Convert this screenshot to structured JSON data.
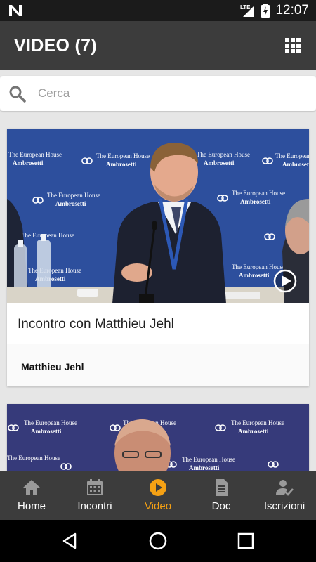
{
  "status_bar": {
    "time": "12:07",
    "network": "LTE",
    "icons": [
      "n-logo-icon",
      "signal-icon",
      "battery-charging-icon"
    ]
  },
  "app_bar": {
    "title": "VIDEO (7)",
    "menu_icon": "grid-icon"
  },
  "search": {
    "placeholder": "Cerca",
    "value": "",
    "icon": "search-icon"
  },
  "videos": [
    {
      "title": "Incontro con Matthieu Jehl",
      "author": "Matthieu Jehl",
      "thumbnail_banner_text": [
        "The European House",
        "Ambrosetti"
      ],
      "play_icon": "play-circle-icon"
    },
    {
      "title": "",
      "author": "",
      "thumbnail_banner_text": [
        "The European House",
        "Ambrosetti"
      ]
    }
  ],
  "bottom_nav": {
    "active": "Video",
    "items": [
      {
        "label": "Home",
        "icon": "home-icon"
      },
      {
        "label": "Incontri",
        "icon": "calendar-icon"
      },
      {
        "label": "Video",
        "icon": "play-circle-icon"
      },
      {
        "label": "Doc",
        "icon": "document-icon"
      },
      {
        "label": "Iscrizioni",
        "icon": "person-check-icon"
      }
    ]
  },
  "system_nav": {
    "icons": [
      "back-icon",
      "home-circle-icon",
      "recents-icon"
    ]
  },
  "colors": {
    "app_bar": "#3c3c3c",
    "accent": "#f5a114",
    "background": "#e6e6e6",
    "thumbnail_blue": "#2e4f9c"
  }
}
